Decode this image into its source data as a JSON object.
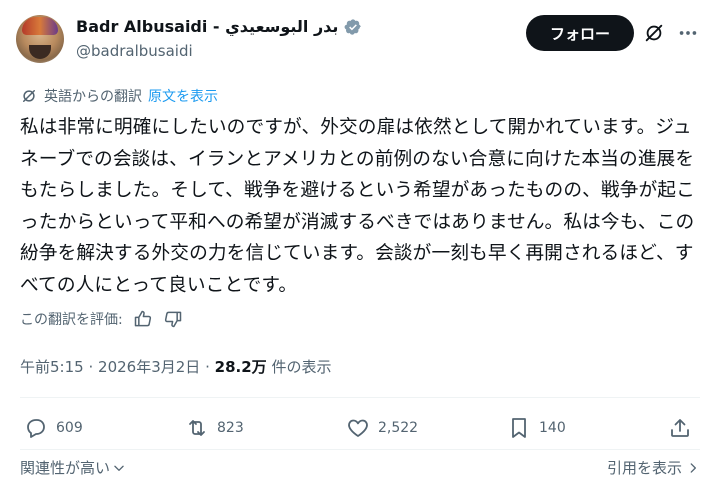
{
  "author": {
    "display_name": "Badr Albusaidi - بدر البوسعيدي",
    "handle": "@badralbusaidi",
    "verified": true
  },
  "header": {
    "follow_label": "フォロー",
    "icons": [
      "grok-icon",
      "more-icon"
    ]
  },
  "translation": {
    "label": "英語からの翻訳",
    "show_original_label": "原文を表示"
  },
  "tweet": {
    "text": "私は非常に明確にしたいのですが、外交の扉は依然として開かれています。ジュネーブでの会談は、イランとアメリカとの前例のない合意に向けた本当の進展をもたらしました。そして、戦争を避けるという希望があったものの、戦争が起こったからといって平和への希望が消滅するべきではありません。私は今も、この紛争を解決する外交の力を信じています。会談が一刻も早く再開されるほど、すべての人にとって良いことです。"
  },
  "rating": {
    "label": "この翻訳を評価:"
  },
  "meta": {
    "time": "午前5:15",
    "separator1": "·",
    "date": "2026年3月2日",
    "separator2": "·",
    "views_count": "28.2万",
    "views_label": "件の表示"
  },
  "actions": {
    "replies": "609",
    "reposts": "823",
    "likes": "2,522",
    "bookmarks": "140"
  },
  "footer": {
    "sort_label": "関連性が高い",
    "quotes_label": "引用を表示"
  },
  "colors": {
    "text": "#0f1419",
    "secondary": "#536471",
    "link": "#1d9bf0",
    "verified": "#829aab",
    "divider": "#eff3f4"
  }
}
